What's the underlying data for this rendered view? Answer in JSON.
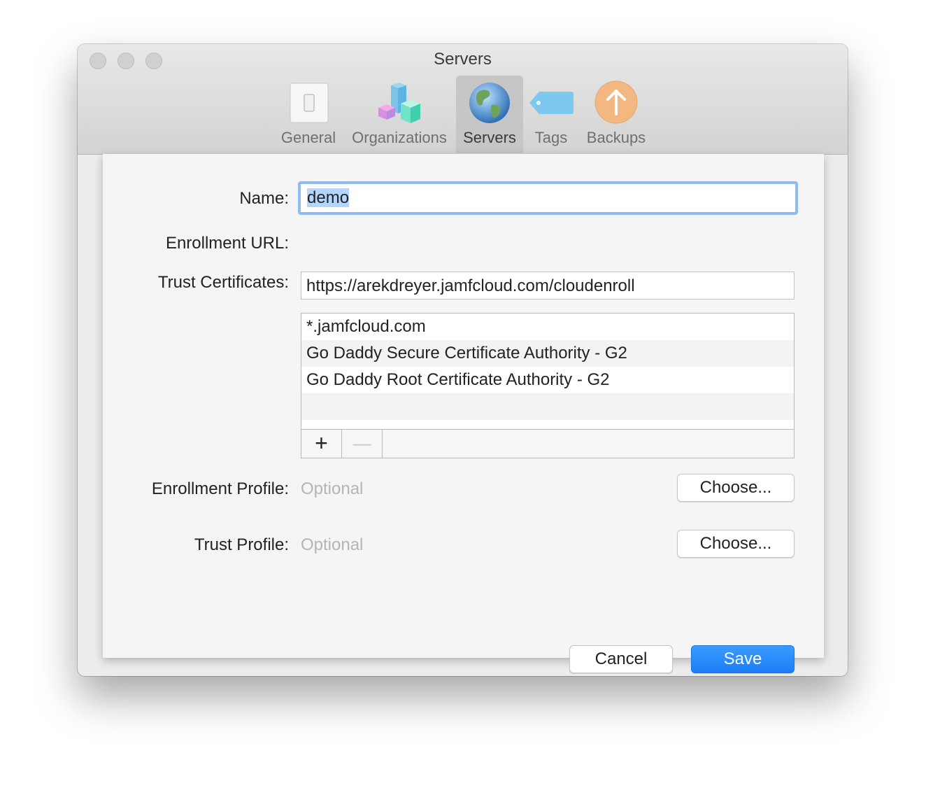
{
  "window": {
    "title": "Servers"
  },
  "toolbar": {
    "items": [
      {
        "label": "General",
        "icon": "switch-icon"
      },
      {
        "label": "Organizations",
        "icon": "blocks-icon"
      },
      {
        "label": "Servers",
        "icon": "globe-icon",
        "selected": true
      },
      {
        "label": "Tags",
        "icon": "tag-icon"
      },
      {
        "label": "Backups",
        "icon": "upload-arrow-icon"
      }
    ]
  },
  "form": {
    "name_label": "Name:",
    "name_value": "demo",
    "enrollment_url_label": "Enrollment URL:",
    "enrollment_url_value": "https://arekdreyer.jamfcloud.com/cloudenroll",
    "trust_certificates_label": "Trust Certificates:",
    "certificates": [
      "*.jamfcloud.com",
      "Go Daddy Secure Certificate Authority - G2",
      "Go Daddy Root Certificate Authority - G2"
    ],
    "add_symbol": "+",
    "remove_symbol": "—",
    "enrollment_profile_label": "Enrollment Profile:",
    "enrollment_profile_placeholder": "Optional",
    "trust_profile_label": "Trust Profile:",
    "trust_profile_placeholder": "Optional",
    "choose_label": "Choose..."
  },
  "actions": {
    "cancel_label": "Cancel",
    "save_label": "Save"
  },
  "colors": {
    "accent": "#1a7ef6",
    "focus_ring": "#8dbdf0",
    "selection": "#b3d6fe"
  }
}
